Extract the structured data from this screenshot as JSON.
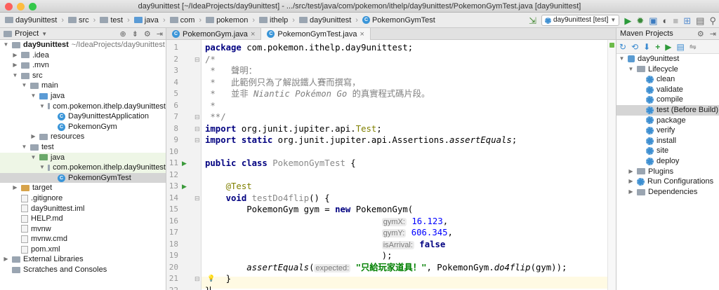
{
  "window": {
    "title": "day9unittest [~/IdeaProjects/day9unittest] - .../src/test/java/com/pokemon/ithelp/day9unittest/PokemonGymTest.java [day9unittest]"
  },
  "breadcrumbs": [
    "day9unittest",
    "src",
    "test",
    "java",
    "com",
    "pokemon",
    "ithelp",
    "day9unittest",
    "PokemonGymTest"
  ],
  "run_config": "day9unittest [test]",
  "project_panel": {
    "title": "Project",
    "tree": [
      {
        "label": "day9unittest",
        "extra": "~/IdeaProjects/day9unittest",
        "icon": "project-folder-icon",
        "arrow": "▼"
      },
      {
        "label": ".idea",
        "icon": "folder-icon",
        "arrow": "▶"
      },
      {
        "label": ".mvn",
        "icon": "folder-icon",
        "arrow": "▶"
      },
      {
        "label": "src",
        "icon": "folder-icon",
        "arrow": "▼"
      },
      {
        "label": "main",
        "icon": "folder-icon",
        "arrow": "▼"
      },
      {
        "label": "java",
        "icon": "source-folder-icon",
        "arrow": "▼"
      },
      {
        "label": "com.pokemon.ithelp.day9unittest",
        "icon": "package-icon",
        "arrow": "▼"
      },
      {
        "label": "Day9unittestApplication",
        "icon": "class-icon",
        "arrow": ""
      },
      {
        "label": "PokemonGym",
        "icon": "class-icon",
        "arrow": ""
      },
      {
        "label": "resources",
        "icon": "resources-folder-icon",
        "arrow": "▶"
      },
      {
        "label": "test",
        "icon": "folder-icon",
        "arrow": "▼"
      },
      {
        "label": "java",
        "icon": "test-folder-icon",
        "arrow": "▼"
      },
      {
        "label": "com.pokemon.ithelp.day9unittest",
        "icon": "package-icon",
        "arrow": "▼"
      },
      {
        "label": "PokemonGymTest",
        "icon": "class-icon",
        "arrow": ""
      },
      {
        "label": "target",
        "icon": "excluded-folder-icon",
        "arrow": "▶"
      },
      {
        "label": ".gitignore",
        "icon": "file-icon",
        "arrow": ""
      },
      {
        "label": "day9unittest.iml",
        "icon": "file-icon",
        "arrow": ""
      },
      {
        "label": "HELP.md",
        "icon": "file-icon",
        "arrow": ""
      },
      {
        "label": "mvnw",
        "icon": "file-icon",
        "arrow": ""
      },
      {
        "label": "mvnw.cmd",
        "icon": "file-icon",
        "arrow": ""
      },
      {
        "label": "pom.xml",
        "icon": "maven-file-icon",
        "arrow": ""
      },
      {
        "label": "External Libraries",
        "icon": "library-icon",
        "arrow": "▶"
      },
      {
        "label": "Scratches and Consoles",
        "icon": "scratch-icon",
        "arrow": ""
      }
    ]
  },
  "tabs": [
    {
      "label": "PokemonGym.java",
      "active": false
    },
    {
      "label": "PokemonGymTest.java",
      "active": true
    }
  ],
  "editor": {
    "line_numbers": [
      "1",
      "2",
      "3",
      "4",
      "5",
      "6",
      "7",
      "8",
      "9",
      "10",
      "11",
      "12",
      "13",
      "14",
      "15",
      "16",
      "17",
      "18",
      "19",
      "20",
      "21",
      "22"
    ],
    "lines": [
      [
        [
          "kw",
          "package "
        ],
        [
          "",
          "com.pokemon.ithelp.day9unittest;"
        ]
      ],
      [
        [
          "cm",
          "/*"
        ]
      ],
      [
        [
          "cm",
          " *   聲明："
        ]
      ],
      [
        [
          "cm",
          " *   此範例只為了解說鐵人賽而撰寫，"
        ]
      ],
      [
        [
          "cm",
          " *   並非 "
        ],
        [
          "cmi",
          "Niantic Pokémon Go"
        ],
        [
          "cm",
          " 的真實程式碼片段。"
        ]
      ],
      [
        [
          "cm",
          " *"
        ]
      ],
      [
        [
          "cm",
          " **/"
        ]
      ],
      [
        [
          "kw",
          "import "
        ],
        [
          "",
          "org.junit.jupiter.api."
        ],
        [
          "an",
          "Test"
        ],
        [
          "",
          ";"
        ]
      ],
      [
        [
          "kw",
          "import static "
        ],
        [
          "",
          "org.junit.jupiter.api.Assertions."
        ],
        [
          "it",
          "assertEquals"
        ],
        [
          "",
          ";"
        ]
      ],
      [],
      [
        [
          "kw",
          "public class "
        ],
        [
          "gr",
          "PokemonGymTest"
        ],
        [
          "",
          " {"
        ]
      ],
      [],
      [
        [
          "",
          "    "
        ],
        [
          "an",
          "@Test"
        ]
      ],
      [
        [
          "",
          "    "
        ],
        [
          "kw",
          "void "
        ],
        [
          "gr",
          "testDo4flip"
        ],
        [
          "",
          "() {"
        ]
      ],
      [
        [
          "",
          "        PokemonGym gym = "
        ],
        [
          "kw",
          "new "
        ],
        [
          "",
          "PokemonGym("
        ]
      ],
      [
        [
          "",
          "                                  "
        ],
        [
          "hint",
          "gymX:"
        ],
        [
          "",
          " "
        ],
        [
          "num",
          "16.123"
        ],
        [
          "",
          ","
        ]
      ],
      [
        [
          "",
          "                                  "
        ],
        [
          "hint",
          "gymY:"
        ],
        [
          "",
          " "
        ],
        [
          "num",
          "606.345"
        ],
        [
          "",
          ","
        ]
      ],
      [
        [
          "",
          "                                  "
        ],
        [
          "hint",
          "isArrival:"
        ],
        [
          "",
          " "
        ],
        [
          "kw",
          "false"
        ]
      ],
      [
        [
          "",
          "                                  );"
        ]
      ],
      [
        [
          "",
          "        "
        ],
        [
          "it",
          "assertEquals"
        ],
        [
          "",
          "("
        ],
        [
          "hint",
          "expected:"
        ],
        [
          "",
          " "
        ],
        [
          "str",
          "\"只給玩家道具！\""
        ],
        [
          "",
          ", PokemonGym."
        ],
        [
          "it",
          "do4flip"
        ],
        [
          "",
          "(gym));"
        ]
      ],
      [
        [
          "",
          "    }"
        ]
      ],
      [
        [
          "",
          "}"
        ]
      ]
    ]
  },
  "maven_panel": {
    "title": "Maven Projects",
    "tree": [
      {
        "label": "day9unittest",
        "icon": "maven-project-icon",
        "arrow": "▼"
      },
      {
        "label": "Lifecycle",
        "icon": "folder-icon",
        "arrow": "▼"
      },
      {
        "label": "clean",
        "icon": "gear-icon",
        "arrow": ""
      },
      {
        "label": "validate",
        "icon": "gear-icon",
        "arrow": ""
      },
      {
        "label": "compile",
        "icon": "gear-icon",
        "arrow": ""
      },
      {
        "label": "test (Before Build)",
        "icon": "gear-icon",
        "arrow": ""
      },
      {
        "label": "package",
        "icon": "gear-icon",
        "arrow": ""
      },
      {
        "label": "verify",
        "icon": "gear-icon",
        "arrow": ""
      },
      {
        "label": "install",
        "icon": "gear-icon",
        "arrow": ""
      },
      {
        "label": "site",
        "icon": "gear-icon",
        "arrow": ""
      },
      {
        "label": "deploy",
        "icon": "gear-icon",
        "arrow": ""
      },
      {
        "label": "Plugins",
        "icon": "folder-icon",
        "arrow": "▶"
      },
      {
        "label": "Run Configurations",
        "icon": "gear-icon",
        "arrow": "▶"
      },
      {
        "label": "Dependencies",
        "icon": "folder-icon",
        "arrow": "▶"
      }
    ]
  }
}
